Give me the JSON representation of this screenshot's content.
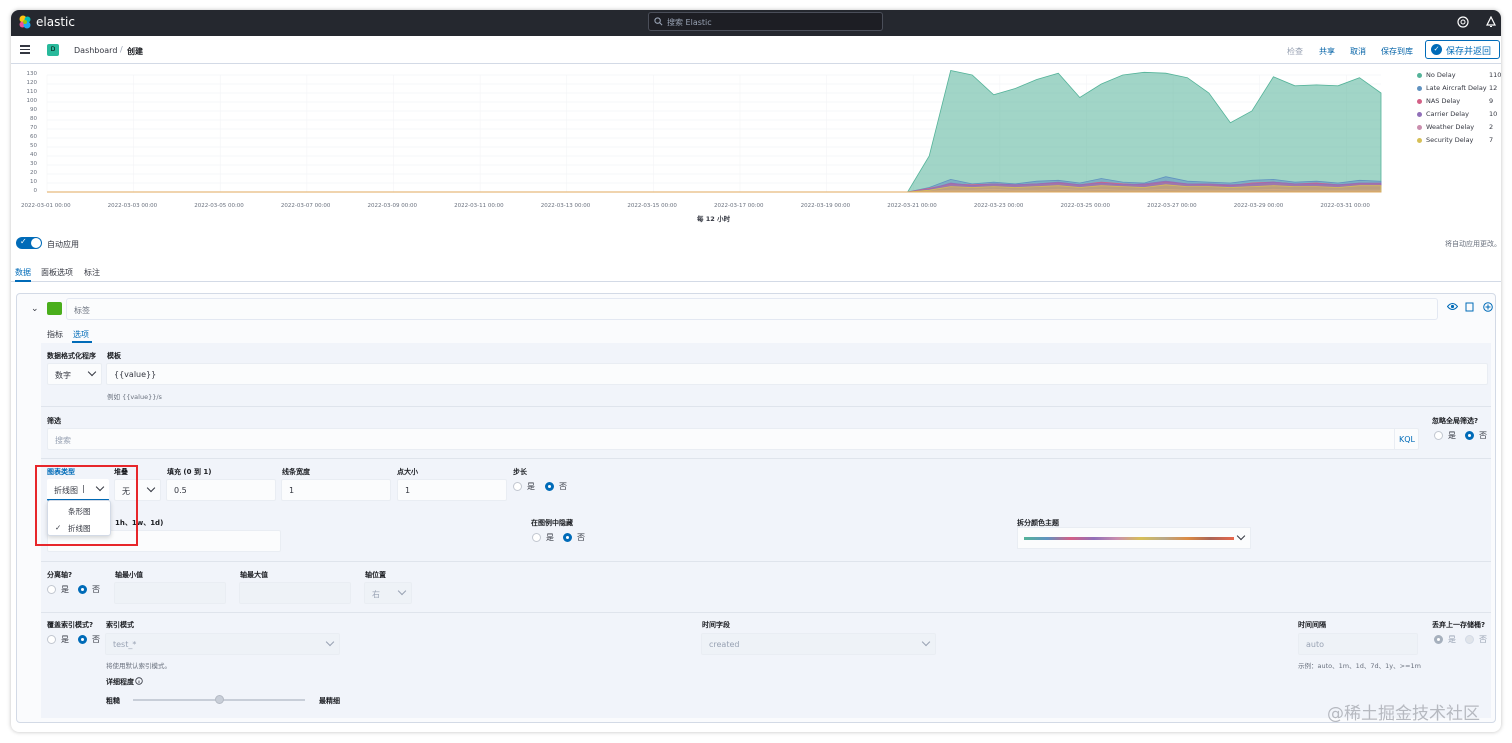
{
  "topbar": {
    "brand": "elastic",
    "search_placeholder": "搜索 Elastic"
  },
  "header": {
    "space_initial": "D",
    "breadcrumb": [
      "Dashboard",
      "创建"
    ],
    "breadcrumb_sep": "/",
    "inspect": "检查",
    "share": "共享",
    "cancel": "取消",
    "save_library": "保存到库",
    "save_return": "保存并返回"
  },
  "chart_data": {
    "type": "area",
    "y_ticks": [
      "130",
      "120",
      "110",
      "100",
      "90",
      "80",
      "70",
      "60",
      "50",
      "40",
      "30",
      "20",
      "10",
      "0"
    ],
    "x_ticks": [
      "2022-03-01 00:00",
      "2022-03-03 00:00",
      "2022-03-05 00:00",
      "2022-03-07 00:00",
      "2022-03-09 00:00",
      "2022-03-11 00:00",
      "2022-03-13 00:00",
      "2022-03-15 00:00",
      "2022-03-17 00:00",
      "2022-03-19 00:00",
      "2022-03-21 00:00",
      "2022-03-23 00:00",
      "2022-03-25 00:00",
      "2022-03-27 00:00",
      "2022-03-29 00:00",
      "2022-03-31 00:00"
    ],
    "xlabel": "每 12 小时",
    "ylim": [
      0,
      130
    ],
    "legend_position": "right",
    "series": [
      {
        "name": "No Delay",
        "value": "110",
        "color": "#54b399",
        "values": [
          0,
          0,
          0,
          0,
          0,
          0,
          0,
          0,
          0,
          0,
          0,
          0,
          0,
          0,
          0,
          0,
          0,
          0,
          0,
          0,
          0,
          0,
          0,
          0,
          0,
          0,
          0,
          0,
          0,
          0,
          0,
          0,
          0,
          0,
          0,
          0,
          0,
          0,
          0,
          0,
          0,
          40,
          135,
          130,
          108,
          115,
          125,
          132,
          105,
          120,
          130,
          133,
          132,
          127,
          110,
          77,
          90,
          128,
          118,
          119,
          118,
          127,
          110
        ]
      },
      {
        "name": "Late Aircraft Delay",
        "value": "12",
        "color": "#6092c0",
        "values": [
          0,
          0,
          0,
          0,
          0,
          0,
          0,
          0,
          0,
          0,
          0,
          0,
          0,
          0,
          0,
          0,
          0,
          0,
          0,
          0,
          0,
          0,
          0,
          0,
          0,
          0,
          0,
          0,
          0,
          0,
          0,
          0,
          0,
          0,
          0,
          0,
          0,
          0,
          0,
          0,
          0,
          5,
          14,
          9,
          11,
          9,
          12,
          13,
          10,
          15,
          11,
          10,
          17,
          12,
          11,
          10,
          13,
          14,
          11,
          12,
          10,
          13,
          12
        ]
      },
      {
        "name": "NAS Delay",
        "value": "9",
        "color": "#d36086",
        "values": [
          0,
          0,
          0,
          0,
          0,
          0,
          0,
          0,
          0,
          0,
          0,
          0,
          0,
          0,
          0,
          0,
          0,
          0,
          0,
          0,
          0,
          0,
          0,
          0,
          0,
          0,
          0,
          0,
          0,
          0,
          0,
          0,
          0,
          0,
          0,
          0,
          0,
          0,
          0,
          0,
          0,
          4,
          9,
          8,
          9,
          8,
          9,
          10,
          8,
          11,
          9,
          8,
          11,
          9,
          8,
          7,
          10,
          11,
          9,
          10,
          8,
          9,
          9
        ]
      },
      {
        "name": "Carrier Delay",
        "value": "10",
        "color": "#9170b8",
        "values": [
          0,
          0,
          0,
          0,
          0,
          0,
          0,
          0,
          0,
          0,
          0,
          0,
          0,
          0,
          0,
          0,
          0,
          0,
          0,
          0,
          0,
          0,
          0,
          0,
          0,
          0,
          0,
          0,
          0,
          0,
          0,
          0,
          0,
          0,
          0,
          0,
          0,
          0,
          0,
          0,
          0,
          3,
          10,
          7,
          9,
          8,
          9,
          11,
          8,
          10,
          8,
          9,
          12,
          9,
          9,
          8,
          9,
          11,
          9,
          9,
          8,
          10,
          10
        ]
      },
      {
        "name": "Weather Delay",
        "value": "2",
        "color": "#ca8eae",
        "values": [
          0,
          0,
          0,
          0,
          0,
          0,
          0,
          0,
          0,
          0,
          0,
          0,
          0,
          0,
          0,
          0,
          0,
          0,
          0,
          0,
          0,
          0,
          0,
          0,
          0,
          0,
          0,
          0,
          0,
          0,
          0,
          0,
          0,
          0,
          0,
          0,
          0,
          0,
          0,
          0,
          0,
          1,
          2,
          2,
          3,
          2,
          2,
          3,
          2,
          3,
          2,
          2,
          3,
          2,
          2,
          2,
          2,
          3,
          2,
          2,
          2,
          2,
          2
        ]
      },
      {
        "name": "Security Delay",
        "value": "7",
        "color": "#d6bf57",
        "values": [
          0,
          0,
          0,
          0,
          0,
          0,
          0,
          0,
          0,
          0,
          0,
          0,
          0,
          0,
          0,
          0,
          0,
          0,
          0,
          0,
          0,
          0,
          0,
          0,
          0,
          0,
          0,
          0,
          0,
          0,
          0,
          0,
          0,
          0,
          0,
          0,
          0,
          0,
          0,
          0,
          0,
          2,
          6,
          5,
          6,
          5,
          6,
          7,
          5,
          7,
          6,
          5,
          8,
          6,
          6,
          5,
          6,
          7,
          6,
          6,
          5,
          7,
          7
        ]
      }
    ]
  },
  "autoapply": {
    "label": "自动应用",
    "note": "将自动应用更改。"
  },
  "tabs": [
    "数据",
    "面板选项",
    "标注"
  ],
  "series_panel": {
    "label_placeholder": "标签",
    "swatch_color": "#4aae1c",
    "subtabs": [
      "指标",
      "选项"
    ],
    "formatter_label": "数据格式化程序",
    "formatter_value": "数字",
    "template_label": "模板",
    "template_value": "{{value}}",
    "template_help": "例如  {{value}}/s",
    "filter_label": "筛选",
    "filter_placeholder": "搜索",
    "kql": "KQL",
    "ignore_global_label": "忽略全局筛选?",
    "chart_type_label": "图表类型",
    "chart_type_value": "折线图",
    "chart_type_options": [
      "条形图",
      "折线图"
    ],
    "stacked_label": "堆叠",
    "stacked_value": "无",
    "fill_label": "填充 (0 到 1)",
    "fill_value": "0.5",
    "line_width_label": "线条宽度",
    "line_width_value": "1",
    "point_size_label": "点大小",
    "point_size_value": "1",
    "steps_label": "步长",
    "offset_label": "1h、1w、1d)",
    "hide_legend_label": "在图例中隐藏",
    "split_palette_label": "拆分颜色主题",
    "separate_axis_label": "分离轴?",
    "axis_min_label": "轴最小值",
    "axis_max_label": "轴最大值",
    "axis_pos_label": "轴位置",
    "axis_pos_value": "右",
    "override_index_label": "覆盖索引模式?",
    "index_pattern_label": "索引模式",
    "index_pattern_value": "test_*",
    "index_help": "将使用默认索引模式。",
    "time_field_label": "时间字段",
    "time_field_value": "created",
    "interval_label": "时间间隔",
    "interval_value": "auto",
    "interval_help": "示例：auto、1m、1d、7d、1y、>=1m",
    "drop_last_label": "丢弃上一存储桶?",
    "detail_label": "详细程度",
    "coarse": "粗糙",
    "finest": "最精细",
    "yes": "是",
    "no": "否"
  },
  "watermark": "@稀土掘金技术社区"
}
